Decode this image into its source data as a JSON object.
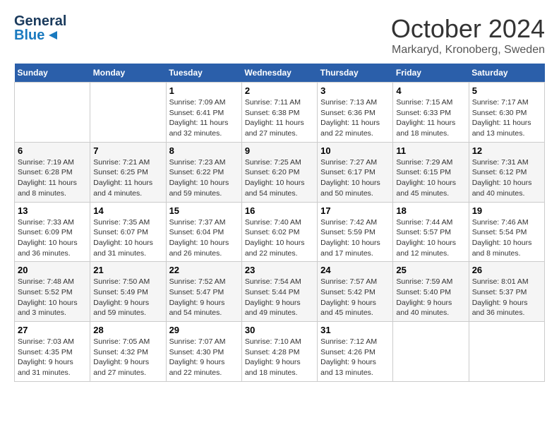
{
  "header": {
    "logo_line1": "General",
    "logo_line2": "Blue",
    "month": "October 2024",
    "location": "Markaryd, Kronoberg, Sweden"
  },
  "days_of_week": [
    "Sunday",
    "Monday",
    "Tuesday",
    "Wednesday",
    "Thursday",
    "Friday",
    "Saturday"
  ],
  "weeks": [
    [
      {
        "day": "",
        "sunrise": "",
        "sunset": "",
        "daylight": ""
      },
      {
        "day": "",
        "sunrise": "",
        "sunset": "",
        "daylight": ""
      },
      {
        "day": "1",
        "sunrise": "Sunrise: 7:09 AM",
        "sunset": "Sunset: 6:41 PM",
        "daylight": "Daylight: 11 hours and 32 minutes."
      },
      {
        "day": "2",
        "sunrise": "Sunrise: 7:11 AM",
        "sunset": "Sunset: 6:38 PM",
        "daylight": "Daylight: 11 hours and 27 minutes."
      },
      {
        "day": "3",
        "sunrise": "Sunrise: 7:13 AM",
        "sunset": "Sunset: 6:36 PM",
        "daylight": "Daylight: 11 hours and 22 minutes."
      },
      {
        "day": "4",
        "sunrise": "Sunrise: 7:15 AM",
        "sunset": "Sunset: 6:33 PM",
        "daylight": "Daylight: 11 hours and 18 minutes."
      },
      {
        "day": "5",
        "sunrise": "Sunrise: 7:17 AM",
        "sunset": "Sunset: 6:30 PM",
        "daylight": "Daylight: 11 hours and 13 minutes."
      }
    ],
    [
      {
        "day": "6",
        "sunrise": "Sunrise: 7:19 AM",
        "sunset": "Sunset: 6:28 PM",
        "daylight": "Daylight: 11 hours and 8 minutes."
      },
      {
        "day": "7",
        "sunrise": "Sunrise: 7:21 AM",
        "sunset": "Sunset: 6:25 PM",
        "daylight": "Daylight: 11 hours and 4 minutes."
      },
      {
        "day": "8",
        "sunrise": "Sunrise: 7:23 AM",
        "sunset": "Sunset: 6:22 PM",
        "daylight": "Daylight: 10 hours and 59 minutes."
      },
      {
        "day": "9",
        "sunrise": "Sunrise: 7:25 AM",
        "sunset": "Sunset: 6:20 PM",
        "daylight": "Daylight: 10 hours and 54 minutes."
      },
      {
        "day": "10",
        "sunrise": "Sunrise: 7:27 AM",
        "sunset": "Sunset: 6:17 PM",
        "daylight": "Daylight: 10 hours and 50 minutes."
      },
      {
        "day": "11",
        "sunrise": "Sunrise: 7:29 AM",
        "sunset": "Sunset: 6:15 PM",
        "daylight": "Daylight: 10 hours and 45 minutes."
      },
      {
        "day": "12",
        "sunrise": "Sunrise: 7:31 AM",
        "sunset": "Sunset: 6:12 PM",
        "daylight": "Daylight: 10 hours and 40 minutes."
      }
    ],
    [
      {
        "day": "13",
        "sunrise": "Sunrise: 7:33 AM",
        "sunset": "Sunset: 6:09 PM",
        "daylight": "Daylight: 10 hours and 36 minutes."
      },
      {
        "day": "14",
        "sunrise": "Sunrise: 7:35 AM",
        "sunset": "Sunset: 6:07 PM",
        "daylight": "Daylight: 10 hours and 31 minutes."
      },
      {
        "day": "15",
        "sunrise": "Sunrise: 7:37 AM",
        "sunset": "Sunset: 6:04 PM",
        "daylight": "Daylight: 10 hours and 26 minutes."
      },
      {
        "day": "16",
        "sunrise": "Sunrise: 7:40 AM",
        "sunset": "Sunset: 6:02 PM",
        "daylight": "Daylight: 10 hours and 22 minutes."
      },
      {
        "day": "17",
        "sunrise": "Sunrise: 7:42 AM",
        "sunset": "Sunset: 5:59 PM",
        "daylight": "Daylight: 10 hours and 17 minutes."
      },
      {
        "day": "18",
        "sunrise": "Sunrise: 7:44 AM",
        "sunset": "Sunset: 5:57 PM",
        "daylight": "Daylight: 10 hours and 12 minutes."
      },
      {
        "day": "19",
        "sunrise": "Sunrise: 7:46 AM",
        "sunset": "Sunset: 5:54 PM",
        "daylight": "Daylight: 10 hours and 8 minutes."
      }
    ],
    [
      {
        "day": "20",
        "sunrise": "Sunrise: 7:48 AM",
        "sunset": "Sunset: 5:52 PM",
        "daylight": "Daylight: 10 hours and 3 minutes."
      },
      {
        "day": "21",
        "sunrise": "Sunrise: 7:50 AM",
        "sunset": "Sunset: 5:49 PM",
        "daylight": "Daylight: 9 hours and 59 minutes."
      },
      {
        "day": "22",
        "sunrise": "Sunrise: 7:52 AM",
        "sunset": "Sunset: 5:47 PM",
        "daylight": "Daylight: 9 hours and 54 minutes."
      },
      {
        "day": "23",
        "sunrise": "Sunrise: 7:54 AM",
        "sunset": "Sunset: 5:44 PM",
        "daylight": "Daylight: 9 hours and 49 minutes."
      },
      {
        "day": "24",
        "sunrise": "Sunrise: 7:57 AM",
        "sunset": "Sunset: 5:42 PM",
        "daylight": "Daylight: 9 hours and 45 minutes."
      },
      {
        "day": "25",
        "sunrise": "Sunrise: 7:59 AM",
        "sunset": "Sunset: 5:40 PM",
        "daylight": "Daylight: 9 hours and 40 minutes."
      },
      {
        "day": "26",
        "sunrise": "Sunrise: 8:01 AM",
        "sunset": "Sunset: 5:37 PM",
        "daylight": "Daylight: 9 hours and 36 minutes."
      }
    ],
    [
      {
        "day": "27",
        "sunrise": "Sunrise: 7:03 AM",
        "sunset": "Sunset: 4:35 PM",
        "daylight": "Daylight: 9 hours and 31 minutes."
      },
      {
        "day": "28",
        "sunrise": "Sunrise: 7:05 AM",
        "sunset": "Sunset: 4:32 PM",
        "daylight": "Daylight: 9 hours and 27 minutes."
      },
      {
        "day": "29",
        "sunrise": "Sunrise: 7:07 AM",
        "sunset": "Sunset: 4:30 PM",
        "daylight": "Daylight: 9 hours and 22 minutes."
      },
      {
        "day": "30",
        "sunrise": "Sunrise: 7:10 AM",
        "sunset": "Sunset: 4:28 PM",
        "daylight": "Daylight: 9 hours and 18 minutes."
      },
      {
        "day": "31",
        "sunrise": "Sunrise: 7:12 AM",
        "sunset": "Sunset: 4:26 PM",
        "daylight": "Daylight: 9 hours and 13 minutes."
      },
      {
        "day": "",
        "sunrise": "",
        "sunset": "",
        "daylight": ""
      },
      {
        "day": "",
        "sunrise": "",
        "sunset": "",
        "daylight": ""
      }
    ]
  ]
}
